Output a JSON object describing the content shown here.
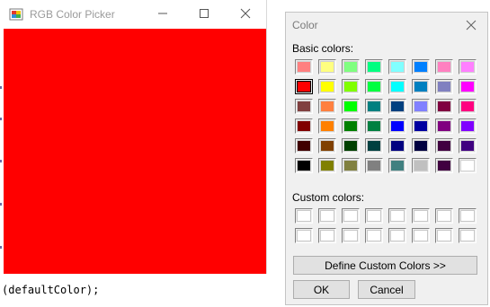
{
  "rgb_window": {
    "title": "RGB Color Picker",
    "current_color": "#FF0000",
    "code_fragment": "(defaultColor);"
  },
  "color_dialog": {
    "title": "Color",
    "basic_colors_label": "Basic colors:",
    "custom_colors_label": "Custom colors:",
    "basic_colors": [
      "#FF8080",
      "#FFFF80",
      "#80FF80",
      "#00FF80",
      "#80FFFF",
      "#0080FF",
      "#FF80C0",
      "#FF80FF",
      "#FF0000",
      "#FFFF00",
      "#80FF00",
      "#00FF40",
      "#00FFFF",
      "#0080C0",
      "#8080C0",
      "#FF00FF",
      "#804040",
      "#FF8040",
      "#00FF00",
      "#008080",
      "#004080",
      "#8080FF",
      "#800040",
      "#FF0080",
      "#800000",
      "#FF8000",
      "#008000",
      "#008040",
      "#0000FF",
      "#0000A0",
      "#800080",
      "#8000FF",
      "#400000",
      "#804000",
      "#004000",
      "#004040",
      "#000080",
      "#000040",
      "#400040",
      "#400080",
      "#000000",
      "#808000",
      "#808040",
      "#808080",
      "#408080",
      "#C0C0C0",
      "#400040",
      "#FFFFFF"
    ],
    "selected_index": 8,
    "custom_colors": [
      "#FFFFFF",
      "#FFFFFF",
      "#FFFFFF",
      "#FFFFFF",
      "#FFFFFF",
      "#FFFFFF",
      "#FFFFFF",
      "#FFFFFF",
      "#FFFFFF",
      "#FFFFFF",
      "#FFFFFF",
      "#FFFFFF",
      "#FFFFFF",
      "#FFFFFF",
      "#FFFFFF",
      "#FFFFFF"
    ],
    "define_custom_label": "Define Custom Colors >>",
    "ok_label": "OK",
    "cancel_label": "Cancel"
  },
  "icons": {
    "app": "color-palette-icon",
    "minimize": "minimize-icon",
    "maximize": "maximize-icon",
    "close": "close-icon"
  }
}
